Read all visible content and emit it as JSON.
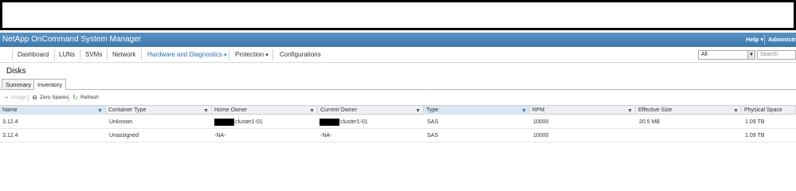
{
  "header": {
    "app_title": "NetApp OnCommand System Manager",
    "help_label": "Help ▾",
    "admin_label": "Administra"
  },
  "nav": {
    "items": [
      {
        "label": "Dashboard"
      },
      {
        "label": "LUNs"
      },
      {
        "label": "SVMs"
      },
      {
        "label": "Network"
      },
      {
        "label": "Hardware and Diagnostics",
        "has_dropdown": true,
        "active": true
      },
      {
        "label": "Protection",
        "has_dropdown": true
      },
      {
        "label": "Configurations"
      }
    ],
    "filter_value": "All",
    "search_placeholder": "Search"
  },
  "page": {
    "title": "Disks"
  },
  "tabs": [
    {
      "label": "Summary",
      "active": false
    },
    {
      "label": "Inventory",
      "active": true
    }
  ],
  "toolbar": {
    "assign_label": "Assign",
    "zero_spares_label": "Zero Spares",
    "refresh_label": "Refresh"
  },
  "table": {
    "columns": [
      "Name",
      "Container Type",
      "Home Owner",
      "Current Owner",
      "Type",
      "RPM",
      "Effective Size",
      "Physical Space"
    ],
    "rows": [
      {
        "name": "3.12.4",
        "container_type": "Unknown",
        "home_owner": "cluster1-01",
        "current_owner": "cluster1-01",
        "type": "SAS",
        "rpm": "10000",
        "effective_size": "20.5 MB",
        "physical_space": "1.09 TB"
      },
      {
        "name": "3.12.4",
        "container_type": "Unassigned",
        "home_owner": "-NA-",
        "current_owner": "-NA-",
        "type": "SAS",
        "rpm": "10000",
        "effective_size": "",
        "physical_space": "1.09 TB"
      }
    ]
  },
  "colors": {
    "title_bar": "#4a86bd",
    "accent": "#2a6fb0",
    "header_bg": "#eef0f3"
  }
}
